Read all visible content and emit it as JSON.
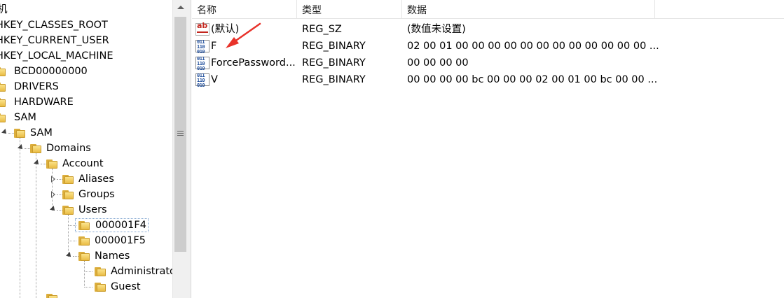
{
  "tree": {
    "root_label": "机",
    "items": [
      {
        "label": "HKEY_CLASSES_ROOT"
      },
      {
        "label": "HKEY_CURRENT_USER"
      },
      {
        "label": "HKEY_LOCAL_MACHINE"
      },
      {
        "label": "BCD00000000"
      },
      {
        "label": "DRIVERS"
      },
      {
        "label": "HARDWARE"
      },
      {
        "label": "SAM"
      },
      {
        "label": "SAM"
      },
      {
        "label": "Domains"
      },
      {
        "label": "Account"
      },
      {
        "label": "Aliases"
      },
      {
        "label": "Groups"
      },
      {
        "label": "Users"
      },
      {
        "label": "000001F4"
      },
      {
        "label": "000001F5"
      },
      {
        "label": "Names"
      },
      {
        "label": "Administrato"
      },
      {
        "label": "Guest"
      }
    ]
  },
  "list": {
    "columns": [
      "名称",
      "类型",
      "数据"
    ],
    "rows": [
      {
        "name": "(默认)",
        "type": "REG_SZ",
        "data": "(数值未设置)",
        "icon": "string-value-icon"
      },
      {
        "name": "F",
        "type": "REG_BINARY",
        "data": "02 00 01 00 00 00 00 00 00 00 00 00 00 00 00 ...",
        "icon": "binary-value-icon"
      },
      {
        "name": "ForcePassword...",
        "type": "REG_BINARY",
        "data": "00 00 00 00",
        "icon": "binary-value-icon"
      },
      {
        "name": "V",
        "type": "REG_BINARY",
        "data": "00 00 00 00 bc 00 00 00 02 00 01 00 bc 00 00 ...",
        "icon": "binary-value-icon"
      }
    ]
  },
  "annotation": {
    "color": "#e8322a"
  }
}
